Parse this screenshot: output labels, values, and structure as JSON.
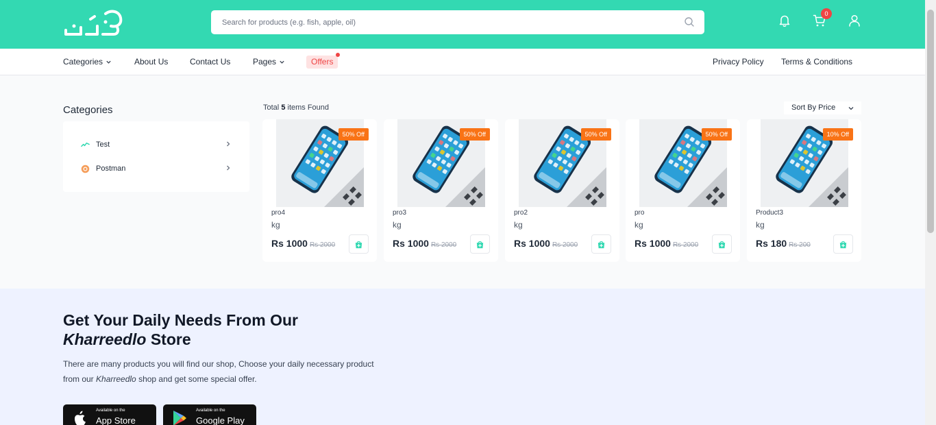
{
  "header": {
    "search_placeholder": "Search for products (e.g. fish, apple, oil)",
    "cart_count": "0",
    "accent_color": "#33d9b2"
  },
  "nav": {
    "categories": "Categories",
    "about": "About Us",
    "contact": "Contact Us",
    "pages": "Pages",
    "offers": "Offers",
    "privacy": "Privacy Policy",
    "terms": "Terms & Conditions"
  },
  "sidebar": {
    "title": "Categories",
    "items": [
      {
        "label": "Test",
        "icon": "wave-icon"
      },
      {
        "label": "Postman",
        "icon": "postman-icon"
      }
    ]
  },
  "results": {
    "total_prefix": "Total",
    "count": "5",
    "total_suffix": "items Found",
    "sort_label": "Sort By Price"
  },
  "products": [
    {
      "name": "pro4",
      "unit": "kg",
      "price": "Rs 1000",
      "old_price": "Rs 2000",
      "badge": "50% Off"
    },
    {
      "name": "pro3",
      "unit": "kg",
      "price": "Rs 1000",
      "old_price": "Rs 2000",
      "badge": "50% Off"
    },
    {
      "name": "pro2",
      "unit": "kg",
      "price": "Rs 1000",
      "old_price": "Rs 2000",
      "badge": "50% Off"
    },
    {
      "name": "pro",
      "unit": "kg",
      "price": "Rs 1000",
      "old_price": "Rs 2000",
      "badge": "50% Off"
    },
    {
      "name": "Product3",
      "unit": "kg",
      "price": "Rs 180",
      "old_price": "Rs 200",
      "badge": "10% Off"
    }
  ],
  "promo": {
    "heading_line1": "Get Your Daily Needs From Our",
    "heading_brand": "Kharreedlo",
    "heading_suffix": " Store",
    "para_a": "There are many products you will find our shop, Choose your daily necessary product from our ",
    "para_brand": "Kharreedlo",
    "para_b": " shop and get some special offer.",
    "appstore_small": "Available on the",
    "appstore_big": "App Store",
    "googleplay_small": "Available on the",
    "googleplay_big": "Google Play"
  }
}
